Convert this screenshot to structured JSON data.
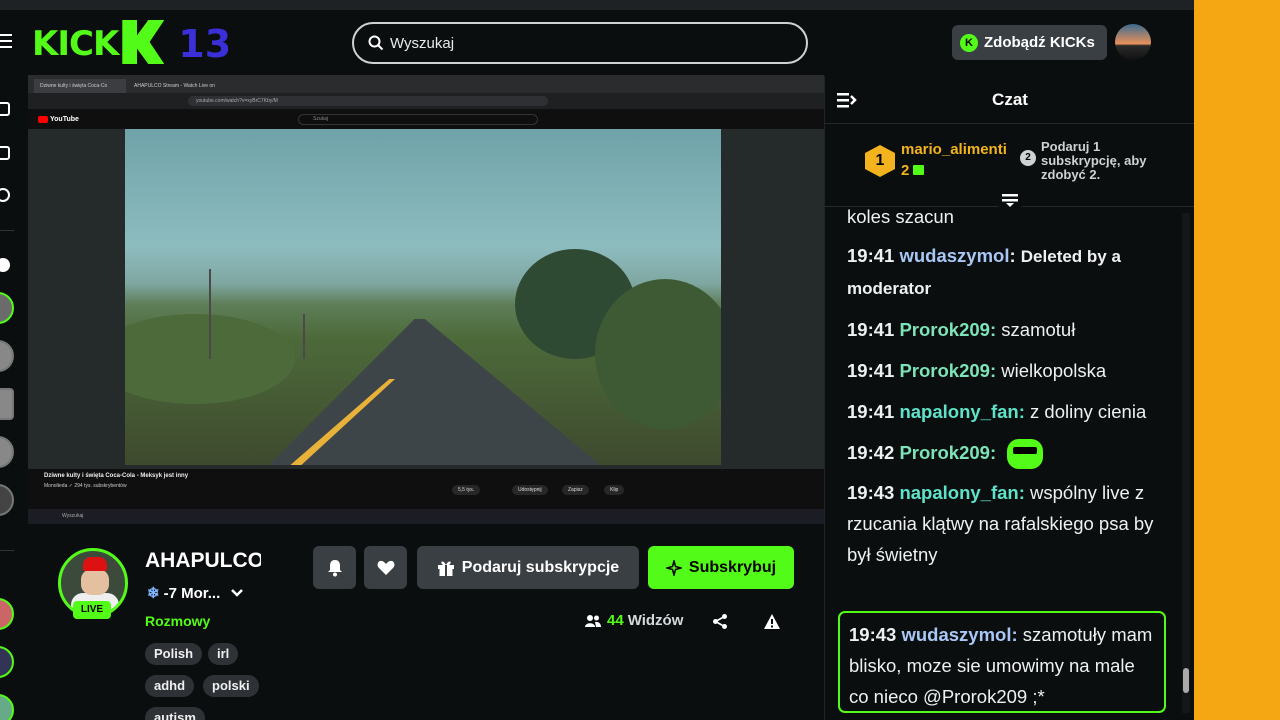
{
  "header": {
    "logo_text": "KICK",
    "logo_number": "13",
    "search_placeholder": "Wyszukaj",
    "kicks_button": "Zdobądź KICKs",
    "kicks_icon_label": "K"
  },
  "video": {
    "browser_tab_1": "Dziwne kulty i święta Coca-Co",
    "browser_tab_2": "AHAPULCO Stream - Watch Live on",
    "address": "youtube.com/watch?v=xyBrC7Kby/M",
    "youtube_logo": "YouTube",
    "youtube_search": "Szukaj",
    "video_title": "Dziwne kulty i święta Coca-Cola - Meksyk jest inny",
    "channel_line": "Monolteda ✓ 294 tys. subskrybentów",
    "actions": [
      "5,5 tys.",
      "Udostępnij",
      "Zapisz",
      "Klip"
    ],
    "taskbar_search": "Wyszukaj"
  },
  "channel": {
    "name": "AHAPULCO",
    "live_badge": "LIVE",
    "stream_title": "-7 Mor...",
    "category": "Rozmowy",
    "tags": [
      "Polish",
      "irl",
      "adhd",
      "polski",
      "autism"
    ],
    "gift_sub_button": "Podaruj subskrypcje",
    "subscribe_button": "Subskrybuj",
    "viewer_count": "44",
    "viewer_label": "Widzów"
  },
  "chat": {
    "title": "Czat",
    "top_gifter": {
      "rank": "1",
      "name": "mario_alimenti",
      "count": "2"
    },
    "promo_rank": "2",
    "promo_text": "Podaruj 1 subskrypcję, aby zdobyć 2.",
    "partial_message": "koles szacun",
    "messages": [
      {
        "time": "19:41",
        "user": "wudaszymol",
        "color": "#a9c7f5",
        "text": "Deleted by a moderator",
        "bold": true
      },
      {
        "time": "19:41",
        "user": "Prorok209",
        "color": "#7de3b8",
        "text": "szamotuł"
      },
      {
        "time": "19:41",
        "user": "Prorok209",
        "color": "#7de3b8",
        "text": "wielkopolska"
      },
      {
        "time": "19:41",
        "user": "napalony_fan",
        "color": "#5ee3c9",
        "text": "z doliny cienia"
      },
      {
        "time": "19:42",
        "user": "Prorok209",
        "color": "#7de3b8",
        "text": ""
      },
      {
        "time": "19:43",
        "user": "napalony_fan",
        "color": "#5ee3c9",
        "text": "wspólny live z rzucania klątwy na rafalskiego psa by był świetny"
      }
    ],
    "highlighted": {
      "time": "19:43",
      "user": "wudaszymol",
      "color": "#a9c7f5",
      "text": "szamotuły mam blisko, moze sie umowimy na male co nieco @Prorok209 ;*"
    },
    "colors": {
      "accent": "#53fc18",
      "gold": "#f2b31e"
    }
  }
}
